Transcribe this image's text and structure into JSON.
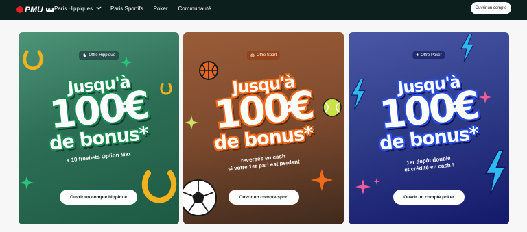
{
  "header": {
    "logo_text": "PMU",
    "logo_suffix": "FR",
    "nav": [
      {
        "label": "Paris Hippiques",
        "has_dropdown": true
      },
      {
        "label": "Paris Sportifs"
      },
      {
        "label": "Poker"
      },
      {
        "label": "Communauté"
      }
    ],
    "open_account_label": "Ouvrir un compte"
  },
  "cards": [
    {
      "badge": "Offre Hippique",
      "line1": "Jusqu'à",
      "amount": "100€",
      "line3": "de bonus*",
      "sub_line1": "+ 10 freebets Option Max",
      "sub_line2": "",
      "cta": "Ouvrir un compte hippique",
      "accent": "#1c8a52"
    },
    {
      "badge": "Offre Sport",
      "line1": "Jusqu'à",
      "amount": "100€",
      "line3": "de bonus*",
      "sub_line1": "reversés en cash",
      "sub_line2": "si votre 1er pari est perdant",
      "cta": "Ouvrir un compte sport",
      "accent": "#f06a1a"
    },
    {
      "badge": "Offre Poker",
      "line1": "Jusqu'à",
      "amount": "100€",
      "line3": "de bonus*",
      "sub_line1": "1er dépôt doublé",
      "sub_line2": "et crédité en cash !",
      "cta": "Ouvrir un compte poker",
      "accent": "#2a4fe0"
    }
  ],
  "icons": {
    "badge_hippique": "horse-icon",
    "badge_sport": "ball-icon",
    "badge_poker": "cards-icon",
    "dropdown": "chevron-down-icon"
  }
}
